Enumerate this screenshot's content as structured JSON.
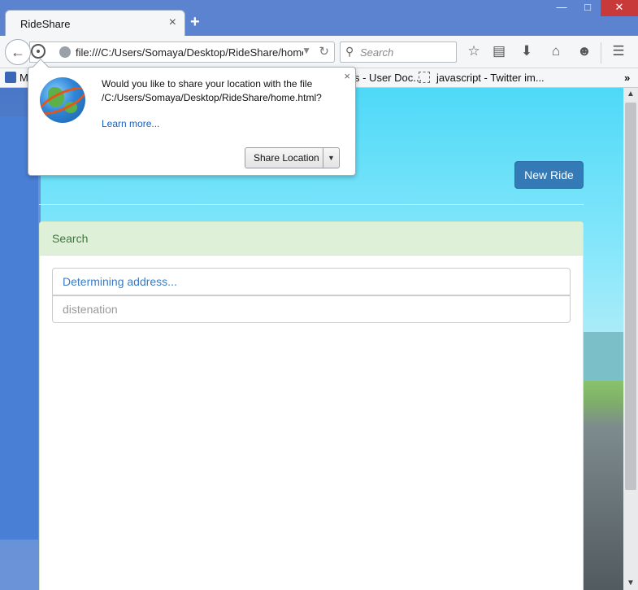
{
  "browser": {
    "tab_title": "RideShare",
    "tab_close": "×",
    "new_tab": "+",
    "url": "file:///C:/Users/Somaya/Desktop/RideShare/home.h",
    "search_placeholder": "Search",
    "bookmarks": [
      {
        "label": "M",
        "icon": "user-docs-icon"
      },
      {
        "label": "s - User Doc...",
        "icon": "none"
      },
      {
        "label": "javascript - Twitter im...",
        "icon": "page-icon"
      }
    ],
    "bookmarks_more": "»"
  },
  "geo_prompt": {
    "message": "Would you like to share your location with the file /C:/Users/Somaya/Desktop/RideShare/home.html?",
    "learn_more": "Learn more...",
    "share_button": "Share Location",
    "close": "×"
  },
  "page": {
    "new_ride_label": "New Ride",
    "search_panel": {
      "heading": "Search",
      "origin_value": "Determining address...",
      "destination_placeholder": "distenation"
    }
  },
  "colors": {
    "titlebar": "#5b83cf",
    "primary_button": "#337ab7",
    "panel_success_bg": "#dff0d8",
    "panel_success_text": "#3c763d",
    "link": "#1a5fbf"
  }
}
